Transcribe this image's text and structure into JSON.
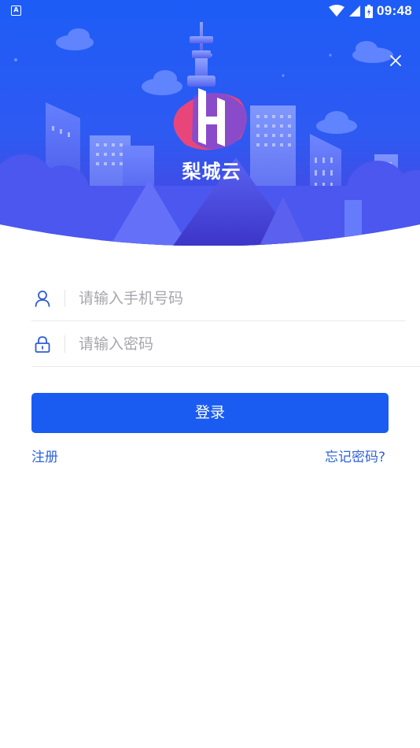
{
  "status_bar": {
    "left_indicator": "A",
    "time": "09:48",
    "icons": [
      "wifi-icon",
      "cell-signal-icon",
      "battery-icon"
    ]
  },
  "brand": {
    "name": "梨城云",
    "logo_letter": "H"
  },
  "login_form": {
    "phone": {
      "placeholder": "请输入手机号码",
      "value": "",
      "icon": "user-icon"
    },
    "password": {
      "placeholder": "请输入密码",
      "value": "",
      "icon": "lock-icon"
    },
    "submit_label": "登录",
    "register_label": "注册",
    "forgot_label": "忘记密码?"
  },
  "colors": {
    "primary": "#1a5cf2",
    "link": "#2f63d8",
    "hero_top": "#1f5cf5",
    "hero_bottom": "#4d3fd8",
    "logo_pink": "#e8467a"
  }
}
